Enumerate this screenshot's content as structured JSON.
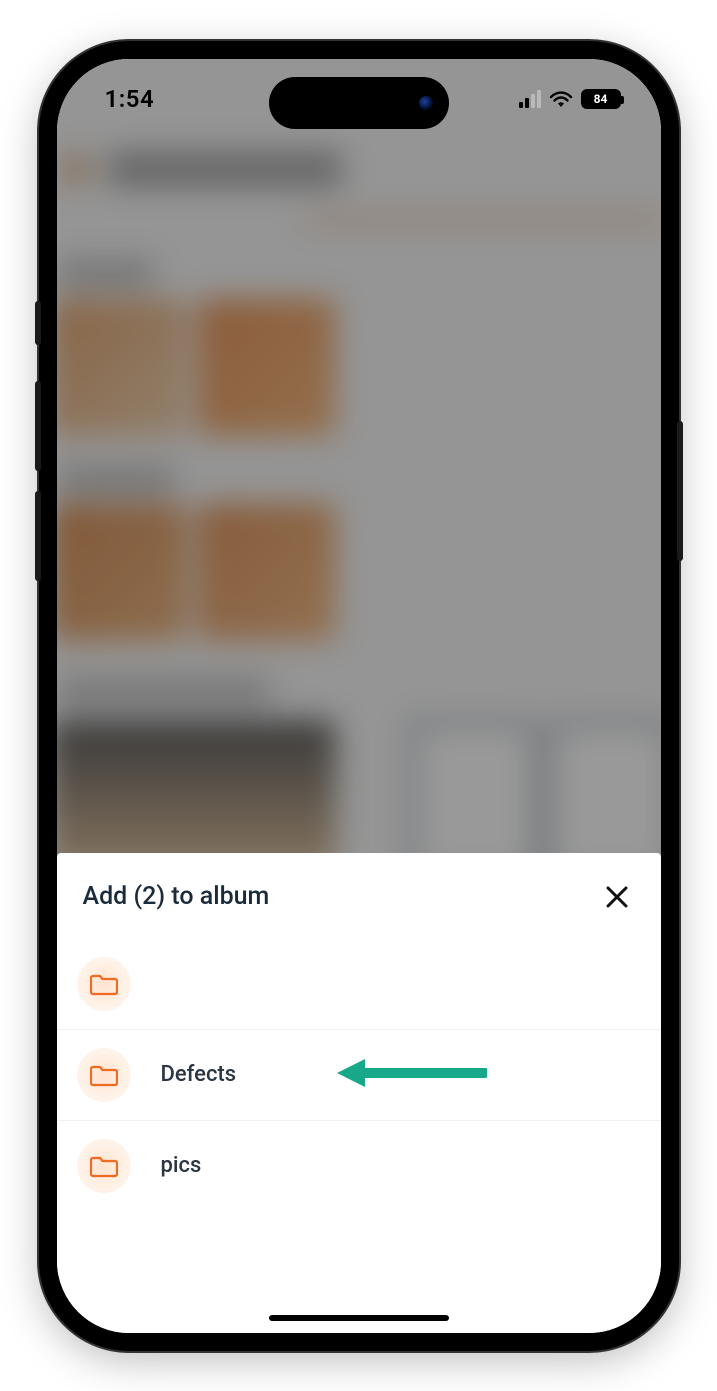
{
  "status": {
    "time": "1:54",
    "battery_pct": "84"
  },
  "sheet": {
    "title": "Add (2) to album",
    "albums": [
      {
        "name": ""
      },
      {
        "name": "Defects"
      },
      {
        "name": "pics"
      }
    ]
  },
  "colors": {
    "accent": "#f16a21",
    "arrow": "#17a889"
  }
}
